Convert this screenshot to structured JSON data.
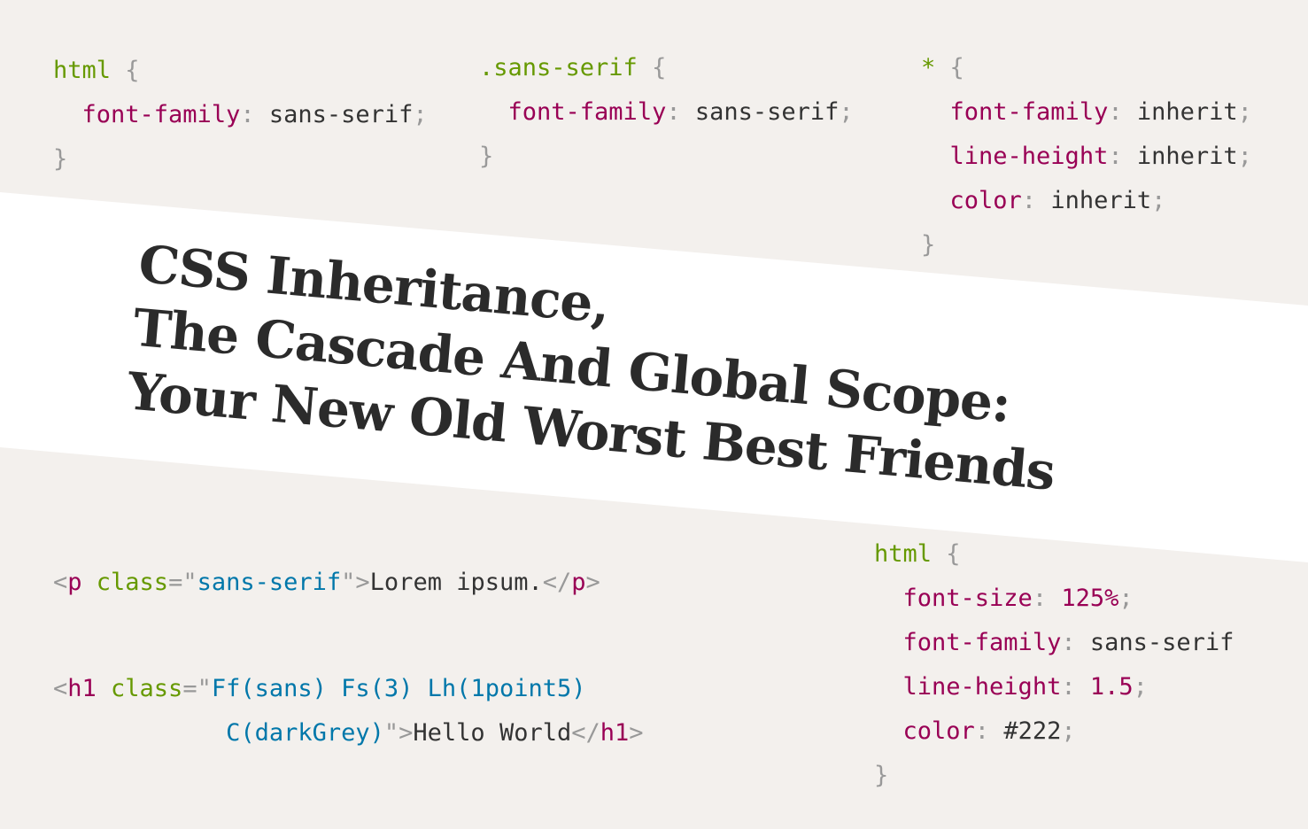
{
  "snippet_html_sans": {
    "selector": "html",
    "open": " {",
    "prop": "font-family",
    "colon": ":",
    "value": " sans-serif",
    "semi": ";",
    "close": "}"
  },
  "snippet_class_sans": {
    "selector": ".sans-serif",
    "open": " {",
    "prop": "font-family",
    "colon": ":",
    "value": " sans-serif",
    "semi": ";",
    "close": "}"
  },
  "snippet_universal": {
    "selector": "*",
    "open": " {",
    "rules": [
      {
        "prop": "font-family",
        "colon": ":",
        "value": " inherit",
        "semi": ";"
      },
      {
        "prop": "line-height",
        "colon": ":",
        "value": " inherit",
        "semi": ";"
      },
      {
        "prop": "color",
        "colon": ":",
        "value": " inherit",
        "semi": ";"
      }
    ],
    "close": "}"
  },
  "title": {
    "line1": "CSS Inheritance,",
    "line2": "The Cascade And Global Scope:",
    "line3": "Your New Old Worst Best Friends"
  },
  "snippet_p_markup": {
    "lt": "<",
    "tag": "p",
    "attr": " class",
    "eq": "=\"",
    "value": "sans-serif",
    "close_quote": "\">",
    "text": "Lorem ipsum.",
    "end_open": "</",
    "end_tag": "p",
    "end_close": ">"
  },
  "snippet_h1_markup": {
    "lt": "<",
    "tag": "h1",
    "attr": " class",
    "eq": "=\"",
    "value_line1": "Ff(sans) Fs(3) Lh(1point5)",
    "indent": "            ",
    "value_line2": "C(darkGrey)",
    "close_quote": "\">",
    "text": "Hello World",
    "end_open": "</",
    "end_tag": "h1",
    "end_close": ">"
  },
  "snippet_html_full": {
    "selector": "html",
    "open": " {",
    "rules": [
      {
        "prop": "font-size",
        "colon": ":",
        "value": " 125%",
        "semi": ";"
      },
      {
        "prop": "font-family",
        "colon": ":",
        "value": " sans-serif",
        "semi": ""
      },
      {
        "prop": "line-height",
        "colon": ":",
        "value": " 1.5",
        "semi": ";"
      },
      {
        "prop": "color",
        "colon": ":",
        "value": " #222",
        "semi": ";"
      }
    ],
    "close": "}"
  }
}
